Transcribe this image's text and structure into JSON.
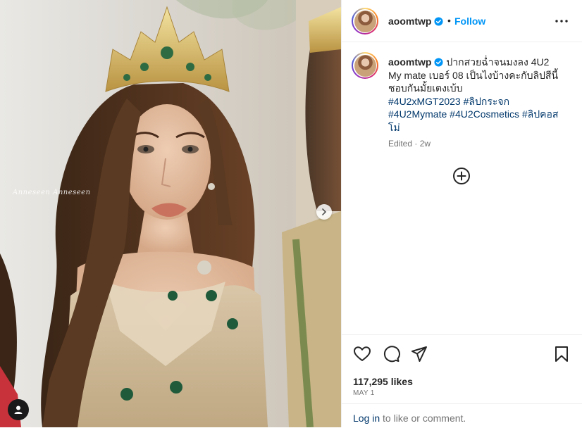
{
  "post": {
    "username": "aoomtwp",
    "verified_icon": "verified-badge-icon",
    "follow_separator": "•",
    "follow_label": "Follow",
    "more_icon": "more-options-icon",
    "caption_username": "aoomtwp",
    "caption_line1": "ปากสวยฉ่ำจนมงลง 4U2",
    "caption_line2": "My mate เบอร์ 08 เป็นไงบ้างคะกับลิปสีนี้",
    "caption_line3": "ชอบกันมั้ยเตงเบ้บ",
    "hashtags_row1": [
      "#4U2xMGT2023",
      "#ลิปกระจก"
    ],
    "hashtags_row2": [
      "#4U2Mymate",
      "#4U2Cosmetics",
      "#ลิปคอส"
    ],
    "hashtag_row2_wrap": "โม่",
    "edited_label": "Edited",
    "meta_separator": "·",
    "time_ago": "2w",
    "likes": "117,295 likes",
    "date": "MAY 1",
    "login_link": "Log in",
    "login_suffix": " to like or comment.",
    "watermark": "Anneseen Anneseen"
  },
  "colors": {
    "accent": "#0095f6",
    "hashtag": "#00376b",
    "muted": "#737373",
    "text": "#262626"
  }
}
